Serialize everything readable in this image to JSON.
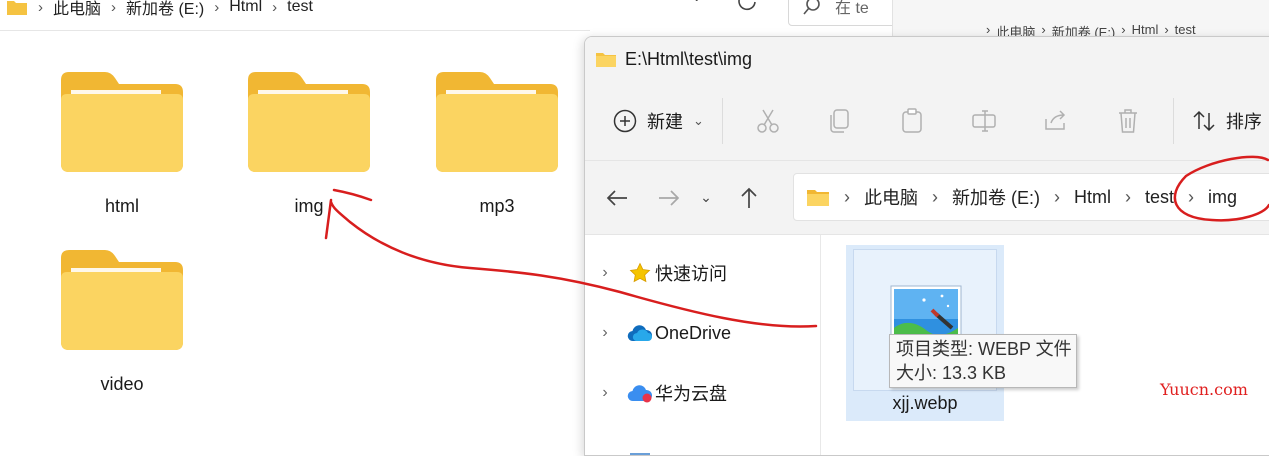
{
  "back_window": {
    "breadcrumb": [
      "此电脑",
      "新加卷 (E:)",
      "Html",
      "test"
    ],
    "search_placeholder": "在 te",
    "folders": [
      {
        "label": "html"
      },
      {
        "label": "img"
      },
      {
        "label": "mp3"
      },
      {
        "label": "video"
      }
    ]
  },
  "third_window": {
    "breadcrumb": [
      "此电脑",
      "新加卷 (E:)",
      "Html",
      "test"
    ]
  },
  "front_window": {
    "title": "E:\\Html\\test\\img",
    "toolbar": {
      "new_label": "新建",
      "sort_label": "排序"
    },
    "address": [
      "此电脑",
      "新加卷 (E:)",
      "Html",
      "test",
      "img"
    ],
    "sidebar": [
      {
        "label": "快速访问",
        "icon": "star-icon"
      },
      {
        "label": "OneDrive",
        "icon": "cloud-icon"
      },
      {
        "label": "华为云盘",
        "icon": "huawei-cloud-icon"
      }
    ],
    "file": {
      "name": "xjj.webp"
    },
    "tooltip": {
      "line1": "项目类型: WEBP 文件",
      "line2": "大小: 13.3 KB"
    }
  },
  "watermark": "Yuucn.com",
  "colors": {
    "folder_front": "#fbd461",
    "folder_back": "#f1b733",
    "annotation": "#d81e1e",
    "selection": "#dbeafa"
  }
}
